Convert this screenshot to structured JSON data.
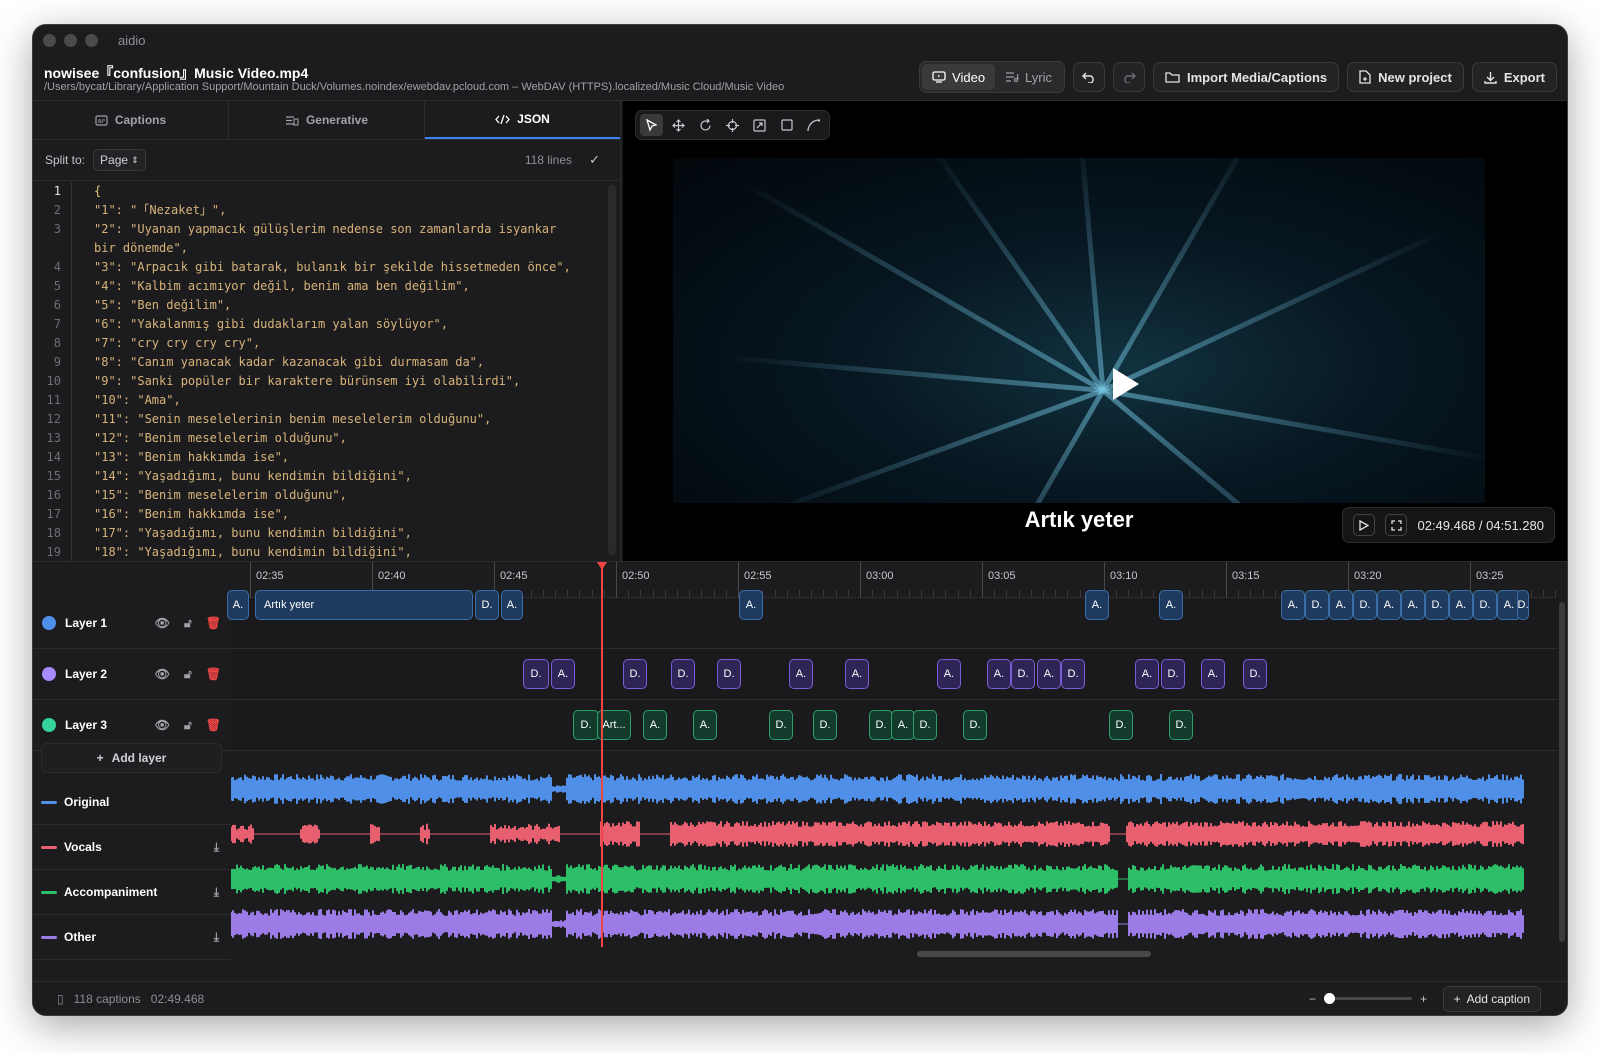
{
  "app": {
    "name": "aidio"
  },
  "file": {
    "title": "nowisee『confusion』Music Video.mp4",
    "path": "/Users/bycat/Library/Application Support/Mountain Duck/Volumes.noindex/ewebdav.pcloud.com – WebDAV (HTTPS).localized/Music Cloud/Music Video"
  },
  "toolbar": {
    "video_label": "Video",
    "lyric_label": "Lyric",
    "import_label": "Import Media/Captions",
    "new_project_label": "New project",
    "export_label": "Export"
  },
  "tabs": [
    {
      "label": "Captions",
      "icon": "captions-icon"
    },
    {
      "label": "Generative",
      "icon": "generative-icon"
    },
    {
      "label": "JSON",
      "icon": "code-icon"
    }
  ],
  "split": {
    "label": "Split to:",
    "value": "Page",
    "lines": "118 lines"
  },
  "code_lines": [
    {
      "n": "1",
      "text": "{"
    },
    {
      "n": "2",
      "text": "\"1\": \"「Nezaket」\","
    },
    {
      "n": "3",
      "text": "\"2\": \"Uyanan yapmacık gülüşlerim nedense son zamanlarda isyankar"
    },
    {
      "n": "",
      "text": "bir dönemde\","
    },
    {
      "n": "4",
      "text": "\"3\": \"Arpacık gibi batarak, bulanık bir şekilde hissetmeden önce\","
    },
    {
      "n": "5",
      "text": "\"4\": \"Kalbim acımıyor değil, benim ama ben değilim\","
    },
    {
      "n": "6",
      "text": "\"5\": \"Ben değilim\","
    },
    {
      "n": "7",
      "text": "\"6\": \"Yakalanmış gibi dudaklarım yalan söylüyor\","
    },
    {
      "n": "8",
      "text": "\"7\": \"cry cry cry cry\","
    },
    {
      "n": "9",
      "text": "\"8\": \"Canım yanacak kadar kazanacak gibi durmasam da\","
    },
    {
      "n": "10",
      "text": "\"9\": \"Sanki popüler bir karaktere bürünsem iyi olabilirdi\","
    },
    {
      "n": "11",
      "text": "\"10\": \"Ama\","
    },
    {
      "n": "12",
      "text": "\"11\": \"Senin meselelerinin benim meselelerim olduğunu\","
    },
    {
      "n": "13",
      "text": "\"12\": \"Benim meselelerim olduğunu\","
    },
    {
      "n": "14",
      "text": "\"13\": \"Benim hakkımda ise\","
    },
    {
      "n": "15",
      "text": "\"14\": \"Yaşadığımı, bunu kendimin bildiğini\","
    },
    {
      "n": "16",
      "text": "\"15\": \"Benim meselelerim olduğunu\","
    },
    {
      "n": "17",
      "text": "\"16\": \"Benim hakkımda ise\","
    },
    {
      "n": "18",
      "text": "\"17\": \"Yaşadığımı, bunu kendimin bildiğini\","
    },
    {
      "n": "19",
      "text": "\"18\": \"Yaşadığımı, bunu kendimin bildiğini\","
    }
  ],
  "video": {
    "subtitle": "Artık yeter",
    "time": "02:49.468 / 04:51.280"
  },
  "ruler": [
    "02:35",
    "02:40",
    "02:45",
    "02:50",
    "02:55",
    "03:00",
    "03:05",
    "03:10",
    "03:15",
    "03:20",
    "03:25"
  ],
  "layers": [
    {
      "name": "Layer 1",
      "color": "#3b82f6"
    },
    {
      "name": "Layer 2",
      "color": "#a78bfa"
    },
    {
      "name": "Layer 3",
      "color": "#34d399"
    }
  ],
  "add_layer_label": "Add layer",
  "clips": {
    "layer1": [
      "A.",
      "Artık yeter",
      "D.",
      "A.",
      "A.",
      "A.",
      "A.",
      "A.",
      "D.",
      "A.",
      "D.",
      "A.",
      "A.",
      "D.",
      "A.",
      "D.",
      "A.",
      "D."
    ],
    "layer2": [
      "D.",
      "A.",
      "D.",
      "D.",
      "D.",
      "A.",
      "A.",
      "A.",
      "A.",
      "D.",
      "A.",
      "D.",
      "A.",
      "D.",
      "A.",
      "D."
    ],
    "layer3": [
      "D.",
      "Art...",
      "A.",
      "A.",
      "D.",
      "D.",
      "D.",
      "A.",
      "D.",
      "D.",
      "D.",
      "D."
    ]
  },
  "tracks": [
    {
      "name": "Original",
      "color": "#4f8fe8",
      "download": false
    },
    {
      "name": "Vocals",
      "color": "#e8606f",
      "download": true
    },
    {
      "name": "Accompaniment",
      "color": "#2dbf67",
      "download": true
    },
    {
      "name": "Other",
      "color": "#9b7be6",
      "download": true
    }
  ],
  "status": {
    "captions": "118 captions",
    "time": "02:49.468",
    "add_caption_label": "Add caption"
  }
}
